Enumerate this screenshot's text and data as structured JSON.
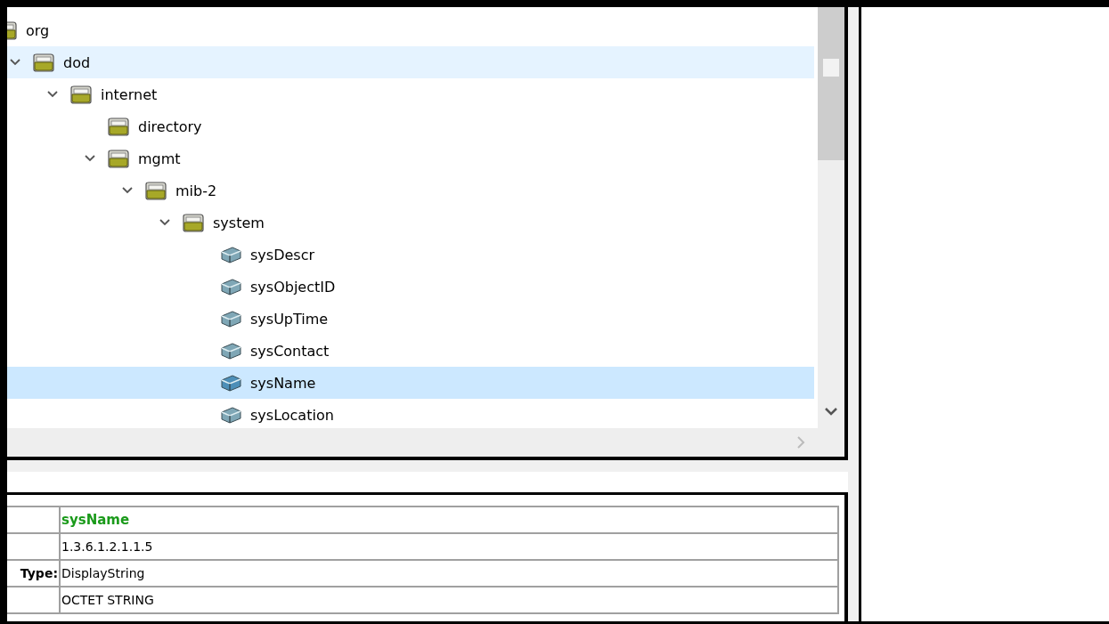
{
  "tree": [
    {
      "label": "org",
      "kind": "folder",
      "expanded": true,
      "selected": false,
      "hovered": false,
      "children": [
        {
          "label": "dod",
          "kind": "folder",
          "expanded": true,
          "selected": false,
          "hovered": true,
          "children": [
            {
              "label": "internet",
              "kind": "folder",
              "expanded": true,
              "selected": false,
              "hovered": false,
              "children": [
                {
                  "label": "directory",
                  "kind": "folder",
                  "selected": false,
                  "hovered": false
                },
                {
                  "label": "mgmt",
                  "kind": "folder",
                  "expanded": true,
                  "selected": false,
                  "hovered": false,
                  "children": [
                    {
                      "label": "mib-2",
                      "kind": "folder",
                      "expanded": true,
                      "selected": false,
                      "hovered": false,
                      "children": [
                        {
                          "label": "system",
                          "kind": "folder",
                          "expanded": true,
                          "selected": false,
                          "hovered": false,
                          "children": [
                            {
                              "label": "sysDescr",
                              "kind": "leaf",
                              "selected": false,
                              "hovered": false
                            },
                            {
                              "label": "sysObjectID",
                              "kind": "leaf",
                              "selected": false,
                              "hovered": false
                            },
                            {
                              "label": "sysUpTime",
                              "kind": "leaf",
                              "selected": false,
                              "hovered": false
                            },
                            {
                              "label": "sysContact",
                              "kind": "leaf",
                              "selected": false,
                              "hovered": false
                            },
                            {
                              "label": "sysName",
                              "kind": "leaf",
                              "selected": true,
                              "hovered": false
                            },
                            {
                              "label": "sysLocation",
                              "kind": "leaf",
                              "selected": false,
                              "hovered": false
                            }
                          ]
                        }
                      ]
                    }
                  ]
                }
              ]
            }
          ]
        }
      ]
    }
  ],
  "details": [
    {
      "kind": "name",
      "value": "sysName"
    },
    {
      "kind": "text",
      "value": "1.3.6.1.2.1.1.5"
    },
    {
      "kind": "text",
      "label": "Type:",
      "value": "DisplayString"
    },
    {
      "kind": "text",
      "value": "OCTET STRING"
    }
  ]
}
